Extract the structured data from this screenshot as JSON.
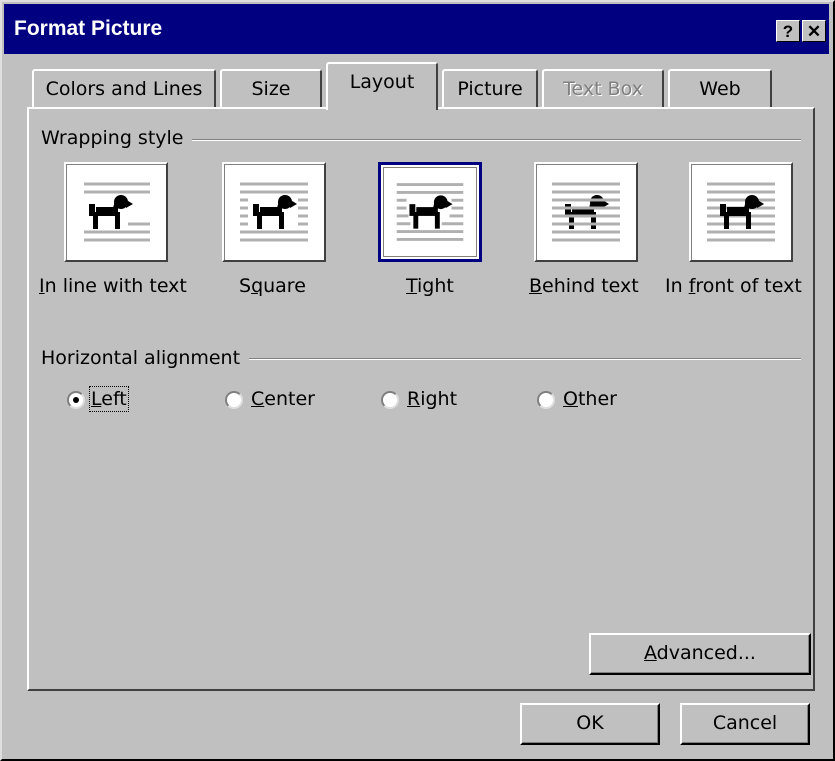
{
  "window": {
    "title": "Format Picture",
    "help_button": "?",
    "close_button": "✕"
  },
  "tabs": [
    {
      "label": "Colors and Lines",
      "state": "normal"
    },
    {
      "label": "Size",
      "state": "normal"
    },
    {
      "label": "Layout",
      "state": "active"
    },
    {
      "label": "Picture",
      "state": "normal"
    },
    {
      "label": "Text Box",
      "state": "disabled"
    },
    {
      "label": "Web",
      "state": "normal"
    }
  ],
  "wrapping": {
    "group_label": "Wrapping style",
    "options": [
      {
        "pre": "",
        "key": "I",
        "post": "n line with text",
        "icon": "inline-wrap-icon",
        "selected": false
      },
      {
        "pre": "S",
        "key": "q",
        "post": "uare",
        "icon": "square-wrap-icon",
        "selected": false
      },
      {
        "pre": "",
        "key": "T",
        "post": "ight",
        "icon": "tight-wrap-icon",
        "selected": true
      },
      {
        "pre": "",
        "key": "B",
        "post": "ehind text",
        "icon": "behind-text-icon",
        "selected": false
      },
      {
        "pre": "In ",
        "key": "f",
        "post": "ront of text",
        "icon": "in-front-of-text-icon",
        "selected": false
      }
    ]
  },
  "alignment": {
    "group_label": "Horizontal alignment",
    "options": [
      {
        "pre": "",
        "key": "L",
        "post": "eft",
        "checked": true
      },
      {
        "pre": "",
        "key": "C",
        "post": "enter",
        "checked": false
      },
      {
        "pre": "",
        "key": "R",
        "post": "ight",
        "checked": false
      },
      {
        "pre": "",
        "key": "O",
        "post": "ther",
        "checked": false
      }
    ]
  },
  "buttons": {
    "advanced": {
      "pre": "",
      "key": "A",
      "post": "dvanced..."
    },
    "ok": "OK",
    "cancel": "Cancel"
  },
  "colors": {
    "titlebar": "#000080",
    "face": "#c0c0c0",
    "selection_border": "#000080"
  }
}
